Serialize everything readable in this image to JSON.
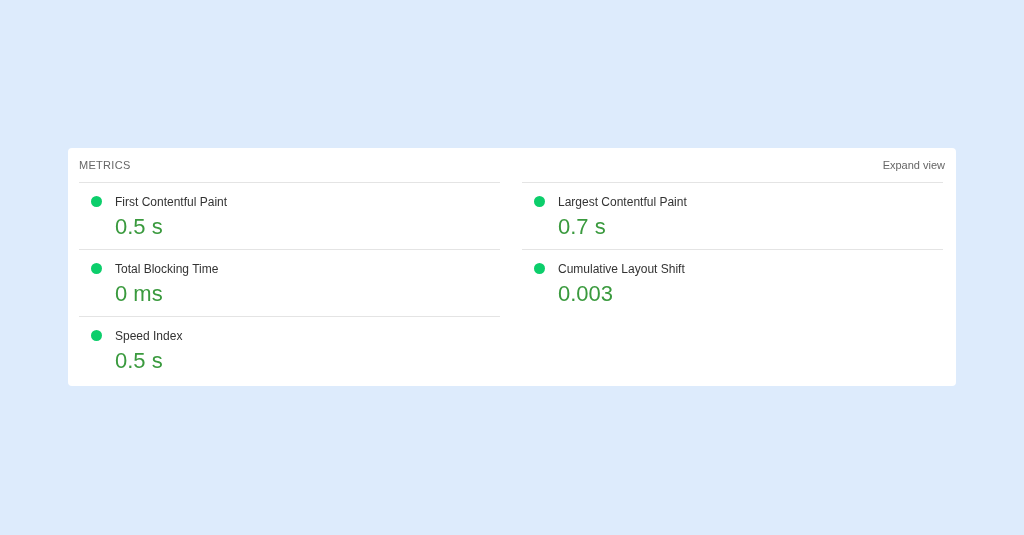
{
  "panel": {
    "title": "METRICS",
    "expand_link": "Expand view"
  },
  "columns": [
    {
      "metrics": [
        {
          "name": "First Contentful Paint",
          "value": "0.5 s",
          "color": "#0cce6b"
        },
        {
          "name": "Total Blocking Time",
          "value": "0 ms",
          "color": "#0cce6b"
        },
        {
          "name": "Speed Index",
          "value": "0.5 s",
          "color": "#0cce6b"
        }
      ]
    },
    {
      "metrics": [
        {
          "name": "Largest Contentful Paint",
          "value": "0.7 s",
          "color": "#0cce6b"
        },
        {
          "name": "Cumulative Layout Shift",
          "value": "0.003",
          "color": "#0cce6b"
        }
      ]
    }
  ]
}
